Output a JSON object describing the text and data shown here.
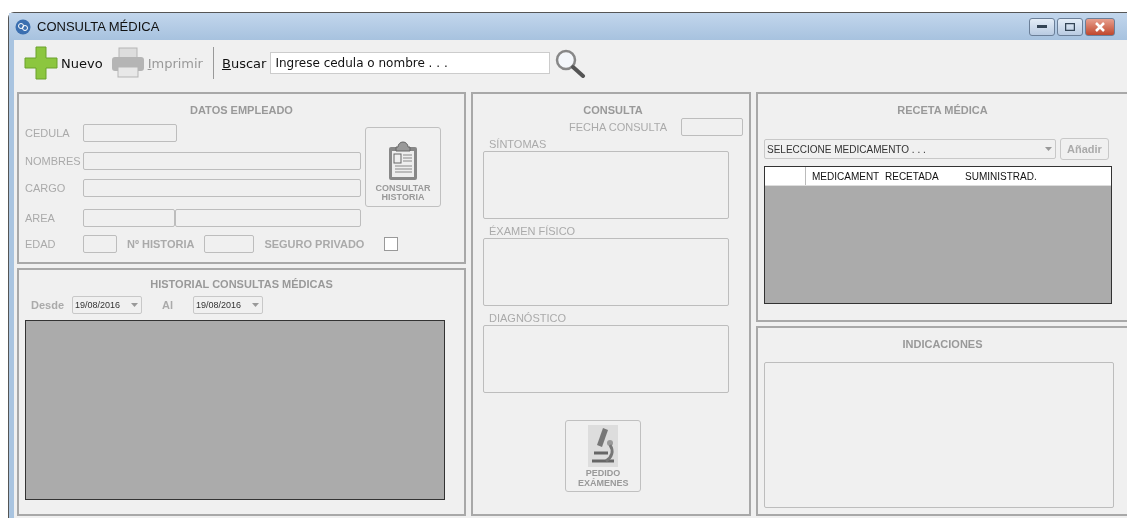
{
  "window": {
    "title": "CONSULTA MÉDICA"
  },
  "toolbar": {
    "buttons": [
      {
        "kind": "new",
        "label": "Nuevo",
        "disabled": false
      },
      {
        "kind": "print",
        "label": "Imprimir",
        "disabled": true
      }
    ],
    "search": {
      "label": "Buscar",
      "placeholder": "Ingrese cedula o nombre . . ."
    }
  },
  "datos_empleado": {
    "title": "DATOS EMPLEADO",
    "cedula": {
      "label": "CEDULA"
    },
    "nombres": {
      "label": "NOMBRES"
    },
    "cargo": {
      "label": "CARGO"
    },
    "area": {
      "label": "AREA"
    },
    "edad": {
      "label": "EDAD"
    },
    "historia": {
      "label": "Nº HISTORIA"
    },
    "seguro": {
      "label": "SEGURO PRIVADO",
      "checked": false
    },
    "button": {
      "label": "CONSULTAR HISTORIA"
    }
  },
  "historial": {
    "title": "HISTORIAL CONSULTAS MÉDICAS",
    "desde": {
      "label": "Desde",
      "value": "19/08/2016"
    },
    "al": {
      "label": "Al",
      "value": "19/08/2016"
    }
  },
  "consulta": {
    "title": "CONSULTA",
    "fecha": {
      "label": "FECHA CONSULTA"
    },
    "areas": [
      {
        "label": "SÍNTOMAS"
      },
      {
        "label": "ÉXAMEN FÍSICO"
      },
      {
        "label": "DIAGNÓSTICO"
      }
    ],
    "button": {
      "label": "PEDIDO EXÁMENES"
    }
  },
  "receta": {
    "title": "RECETA MÉDICA",
    "select": {
      "placeholder": "SELECCIONE MEDICAMENTO . . ."
    },
    "add": {
      "label": "Añadir",
      "disabled": true
    },
    "columns": [
      "MEDICAMENT",
      "RECETADA",
      "SUMINISTRAD."
    ]
  },
  "indicaciones": {
    "title": "INDICACIONES"
  }
}
